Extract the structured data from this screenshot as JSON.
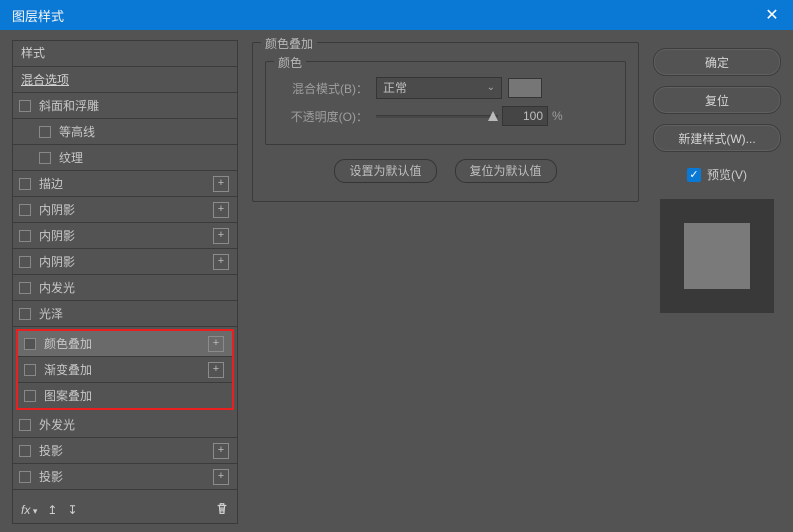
{
  "window": {
    "title": "图层样式"
  },
  "left": {
    "header": "样式",
    "blending": "混合选项",
    "items": [
      {
        "label": "斜面和浮雕",
        "plus": false,
        "indent": false
      },
      {
        "label": "等高线",
        "plus": false,
        "indent": true
      },
      {
        "label": "纹理",
        "plus": false,
        "indent": true
      },
      {
        "label": "描边",
        "plus": true,
        "indent": false
      },
      {
        "label": "内阴影",
        "plus": true,
        "indent": false
      },
      {
        "label": "内阴影",
        "plus": true,
        "indent": false
      },
      {
        "label": "内阴影",
        "plus": true,
        "indent": false
      },
      {
        "label": "内发光",
        "plus": false,
        "indent": false
      },
      {
        "label": "光泽",
        "plus": false,
        "indent": false
      }
    ],
    "overlay_group": [
      {
        "label": "颜色叠加",
        "plus": true,
        "selected": true
      },
      {
        "label": "渐变叠加",
        "plus": true,
        "selected": false
      },
      {
        "label": "图案叠加",
        "plus": false,
        "selected": false
      }
    ],
    "items_after": [
      {
        "label": "外发光",
        "plus": false
      },
      {
        "label": "投影",
        "plus": true
      },
      {
        "label": "投影",
        "plus": true
      }
    ],
    "fx_label": "fx"
  },
  "panel": {
    "title": "颜色叠加",
    "sub_title": "颜色",
    "blend_label": "混合模式(B)：",
    "blend_value": "正常",
    "opacity_label": "不透明度(O)：",
    "opacity_value": "100",
    "opacity_unit": "%",
    "make_default": "设置为默认值",
    "reset_default": "复位为默认值"
  },
  "right": {
    "ok": "确定",
    "cancel": "复位",
    "new_style": "新建样式(W)...",
    "preview": "预览(V)"
  }
}
